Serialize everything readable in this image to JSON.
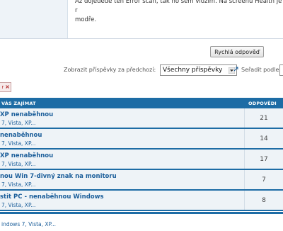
{
  "post": {
    "line1": "Až dojedeďe ten Error scan, tak ho sem vložím. Na screenu Health je r",
    "line2": "modře."
  },
  "reply_button": "Rychlá odpověď",
  "filter": {
    "label": "Zobrazit příspěvky za předchozí:",
    "selected": "Všechny příspěvky",
    "sort_label": "Seřadit podle"
  },
  "close_label": "r",
  "table": {
    "header_title": "VÁS ZAJÍMAT",
    "header_replies": "ODPOVĚDI",
    "rows": [
      {
        "title": "XP nenaběhnou",
        "sub": "7, Vista, XP...",
        "count": "21"
      },
      {
        "title": "nenaběhnou",
        "sub": "7, Vista, XP...",
        "count": "14"
      },
      {
        "title": "XP nenaběhnou",
        "sub": "7, Vista, XP...",
        "count": "17"
      },
      {
        "title": "nou Win 7-divný znak na monitoru",
        "sub": "7, Vista, XP...",
        "count": "7"
      },
      {
        "title": "stit PC - nenaběhnou Windows",
        "sub": "7, Vista, XP...",
        "count": "8"
      }
    ]
  },
  "footer": "indows 7, Vista, XP..."
}
